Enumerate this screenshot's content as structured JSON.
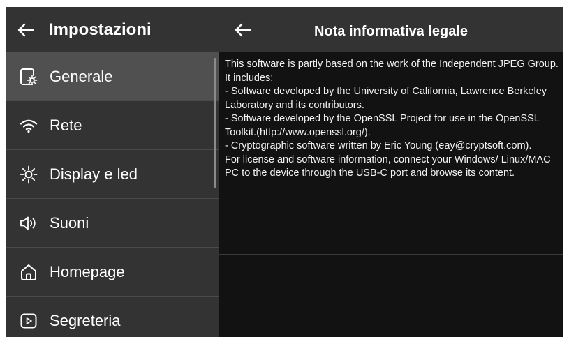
{
  "settings": {
    "title": "Impostazioni",
    "menu": [
      {
        "label": "Generale",
        "icon": "settings-tablet-icon",
        "active": true
      },
      {
        "label": "Rete",
        "icon": "wifi-icon",
        "active": false
      },
      {
        "label": "Display e led",
        "icon": "sun-icon",
        "active": false
      },
      {
        "label": "Suoni",
        "icon": "speaker-icon",
        "active": false
      },
      {
        "label": "Homepage",
        "icon": "home-icon",
        "active": false
      },
      {
        "label": "Segreteria",
        "icon": "play-box-icon",
        "active": false
      }
    ]
  },
  "legal": {
    "title": "Nota informativa legale",
    "lines": [
      "This software is partly based on the work of the Independent JPEG Group.",
      "It includes:",
      "- Software developed by the University of California, Lawrence Berkeley Laboratory and its contributors.",
      "- Software developed by the OpenSSL Project for use in the OpenSSL Toolkit.(http://www.openssl.org/).",
      "- Cryptographic software written by Eric Young (eay@cryptsoft.com).",
      "For license and software information, connect your Windows/ Linux/MAC PC to the device through the USB-C port and browse its content."
    ]
  },
  "colors": {
    "panel_bg": "#333333",
    "active_item_bg": "#505050",
    "content_bg": "#121212",
    "text": "#ffffff"
  }
}
